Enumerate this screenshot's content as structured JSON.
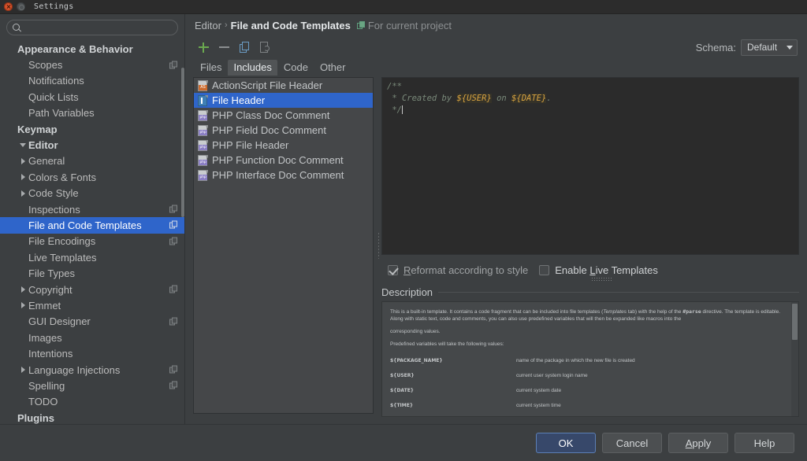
{
  "window": {
    "title": "Settings"
  },
  "sidebar": {
    "search_placeholder": "",
    "search_value": "",
    "items": [
      {
        "label": "Appearance & Behavior",
        "level": 0,
        "twisty": "none",
        "badge": false,
        "selected": false
      },
      {
        "label": "Scopes",
        "level": 1,
        "twisty": "none",
        "badge": true,
        "selected": false
      },
      {
        "label": "Notifications",
        "level": 1,
        "twisty": "none",
        "badge": false,
        "selected": false
      },
      {
        "label": "Quick Lists",
        "level": 1,
        "twisty": "none",
        "badge": false,
        "selected": false
      },
      {
        "label": "Path Variables",
        "level": 1,
        "twisty": "none",
        "badge": false,
        "selected": false
      },
      {
        "label": "Keymap",
        "level": 0,
        "twisty": "none",
        "badge": false,
        "selected": false
      },
      {
        "label": "Editor",
        "level": 0,
        "twisty": "down",
        "badge": false,
        "selected": false
      },
      {
        "label": "General",
        "level": 1,
        "twisty": "right",
        "badge": false,
        "selected": false
      },
      {
        "label": "Colors & Fonts",
        "level": 1,
        "twisty": "right",
        "badge": false,
        "selected": false
      },
      {
        "label": "Code Style",
        "level": 1,
        "twisty": "right",
        "badge": false,
        "selected": false
      },
      {
        "label": "Inspections",
        "level": 1,
        "twisty": "none",
        "badge": true,
        "selected": false
      },
      {
        "label": "File and Code Templates",
        "level": 1,
        "twisty": "none",
        "badge": true,
        "selected": true
      },
      {
        "label": "File Encodings",
        "level": 1,
        "twisty": "none",
        "badge": true,
        "selected": false
      },
      {
        "label": "Live Templates",
        "level": 1,
        "twisty": "none",
        "badge": false,
        "selected": false
      },
      {
        "label": "File Types",
        "level": 1,
        "twisty": "none",
        "badge": false,
        "selected": false
      },
      {
        "label": "Copyright",
        "level": 1,
        "twisty": "right",
        "badge": true,
        "selected": false
      },
      {
        "label": "Emmet",
        "level": 1,
        "twisty": "right",
        "badge": false,
        "selected": false
      },
      {
        "label": "GUI Designer",
        "level": 1,
        "twisty": "none",
        "badge": true,
        "selected": false
      },
      {
        "label": "Images",
        "level": 1,
        "twisty": "none",
        "badge": false,
        "selected": false
      },
      {
        "label": "Intentions",
        "level": 1,
        "twisty": "none",
        "badge": false,
        "selected": false
      },
      {
        "label": "Language Injections",
        "level": 1,
        "twisty": "right",
        "badge": true,
        "selected": false
      },
      {
        "label": "Spelling",
        "level": 1,
        "twisty": "none",
        "badge": true,
        "selected": false
      },
      {
        "label": "TODO",
        "level": 1,
        "twisty": "none",
        "badge": false,
        "selected": false
      },
      {
        "label": "Plugins",
        "level": 0,
        "twisty": "none",
        "badge": false,
        "selected": false
      }
    ]
  },
  "breadcrumb": {
    "root": "Editor",
    "separator": "›",
    "leaf": "File and Code Templates",
    "project_scope": "For current project"
  },
  "toolbar": {
    "add_label": "+",
    "remove_label": "−",
    "copy_label": "Copy Template",
    "reset_label": "Reset To Default"
  },
  "schema": {
    "label": "Schema:",
    "value": "Default"
  },
  "tabs": [
    {
      "label": "Files",
      "active": false
    },
    {
      "label": "Includes",
      "active": true
    },
    {
      "label": "Code",
      "active": false
    },
    {
      "label": "Other",
      "active": false
    }
  ],
  "templates": [
    {
      "label": "ActionScript File Header",
      "icon": "actionscript-file-icon",
      "icon_tag": "AS",
      "selected": false
    },
    {
      "label": "File Header",
      "icon": "file-header-icon",
      "icon_tag": "",
      "selected": true
    },
    {
      "label": "PHP Class Doc Comment",
      "icon": "php-file-icon",
      "icon_tag": "php",
      "selected": false
    },
    {
      "label": "PHP Field Doc Comment",
      "icon": "php-file-icon",
      "icon_tag": "php",
      "selected": false
    },
    {
      "label": "PHP File Header",
      "icon": "php-file-icon",
      "icon_tag": "php",
      "selected": false
    },
    {
      "label": "PHP Function Doc Comment",
      "icon": "php-file-icon",
      "icon_tag": "php",
      "selected": false
    },
    {
      "label": "PHP Interface Doc Comment",
      "icon": "php-file-icon",
      "icon_tag": "php",
      "selected": false
    }
  ],
  "editor": {
    "line1": "/**",
    "line2_pre": " * Created by ",
    "line2_var1": "${USER}",
    "line2_mid": " on ",
    "line2_var2": "${DATE}",
    "line2_post": ".",
    "line3": " */"
  },
  "options": {
    "reformat": {
      "label": "Reformat according to style",
      "mnemonic": "R",
      "checked": true
    },
    "live_templates": {
      "label": "Enable Live Templates",
      "mnemonic": "L",
      "checked": false
    }
  },
  "description": {
    "title": "Description",
    "p1_a": "This is a built-in template. It contains a code fragment that can be included into file templates (",
    "p1_i": "Templates",
    "p1_b": " tab) with the help of the ",
    "p1_code": "#parse",
    "p1_c": " directive. The template is editable. Along with static text, code and comments, you can also use predefined variables that will then be expanded like macros into the",
    "p2": "corresponding values.",
    "p3": "Predefined variables will take the following values:",
    "variables": [
      {
        "name": "${PACKAGE_NAME}",
        "desc": "name of the package in which the new file is created"
      },
      {
        "name": "${USER}",
        "desc": "current user system login name"
      },
      {
        "name": "${DATE}",
        "desc": "current system date"
      },
      {
        "name": "${TIME}",
        "desc": "current system time"
      }
    ]
  },
  "footer": {
    "ok": "OK",
    "cancel": "Cancel",
    "apply": "Apply",
    "apply_mnemonic": "A",
    "help": "Help"
  },
  "colors": {
    "accent_selection": "#2f65ca",
    "panel_bg": "#3c3f41",
    "editor_bg": "#2b2b2b",
    "add_icon": "#6aa84f",
    "variable_text": "#d9a441",
    "comment_text": "#7a8a7a"
  }
}
